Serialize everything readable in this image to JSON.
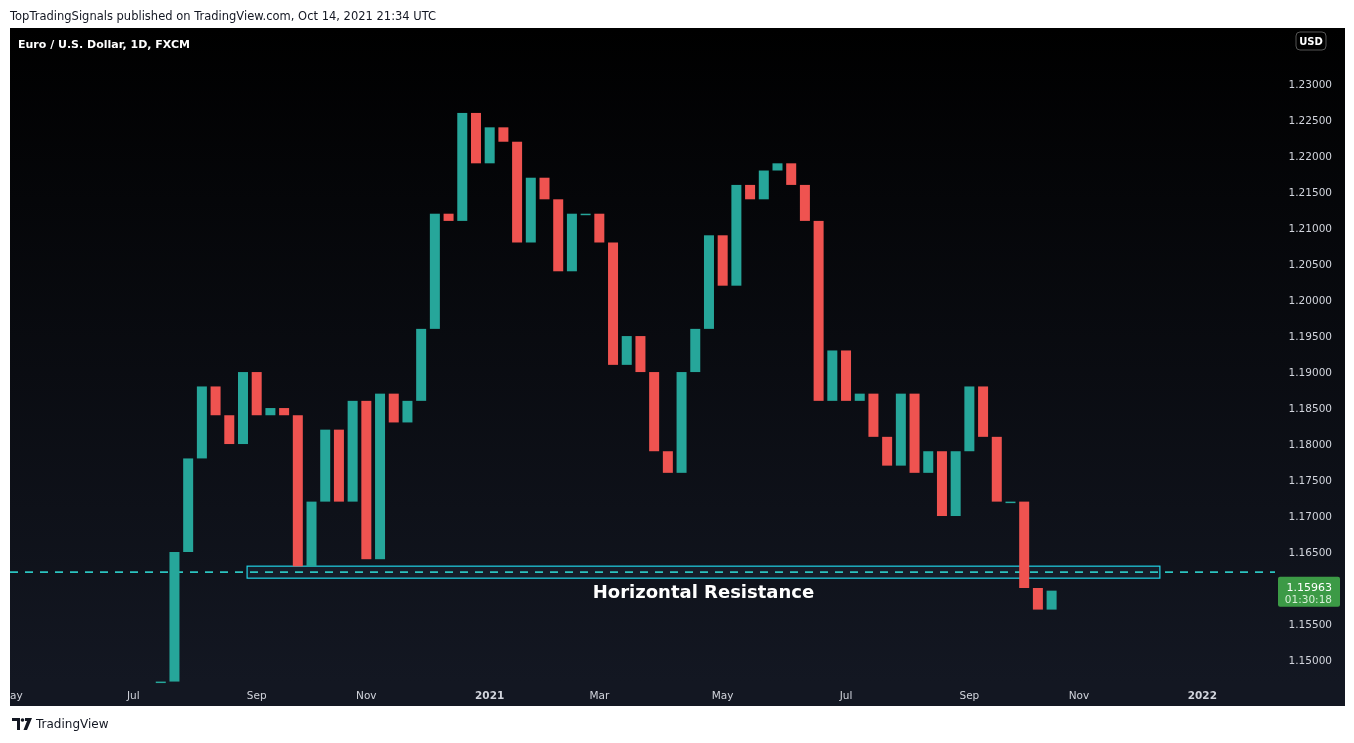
{
  "publisher_line": "TopTradingSignals published on TradingView.com, Oct 14, 2021 21:34 UTC",
  "chart": {
    "symbol_title": "Euro / U.S. Dollar, 1D, FXCM",
    "currency_badge": "USD",
    "price_labels": [
      "1.23000",
      "1.22500",
      "1.22000",
      "1.21500",
      "1.21000",
      "1.20500",
      "1.20000",
      "1.19500",
      "1.19000",
      "1.18500",
      "1.18000",
      "1.17500",
      "1.17000",
      "1.16500",
      "1.15500",
      "1.15000"
    ],
    "time_labels": [
      "ay",
      "Jul",
      "Sep",
      "Nov",
      "2021",
      "Mar",
      "May",
      "Jul",
      "Sep",
      "Nov",
      "2022"
    ],
    "zone_label": "Horizontal Resistance",
    "last_price": {
      "price": "1.15963",
      "countdown": "01:30:18"
    }
  },
  "footer": {
    "brand": "TradingView"
  }
}
